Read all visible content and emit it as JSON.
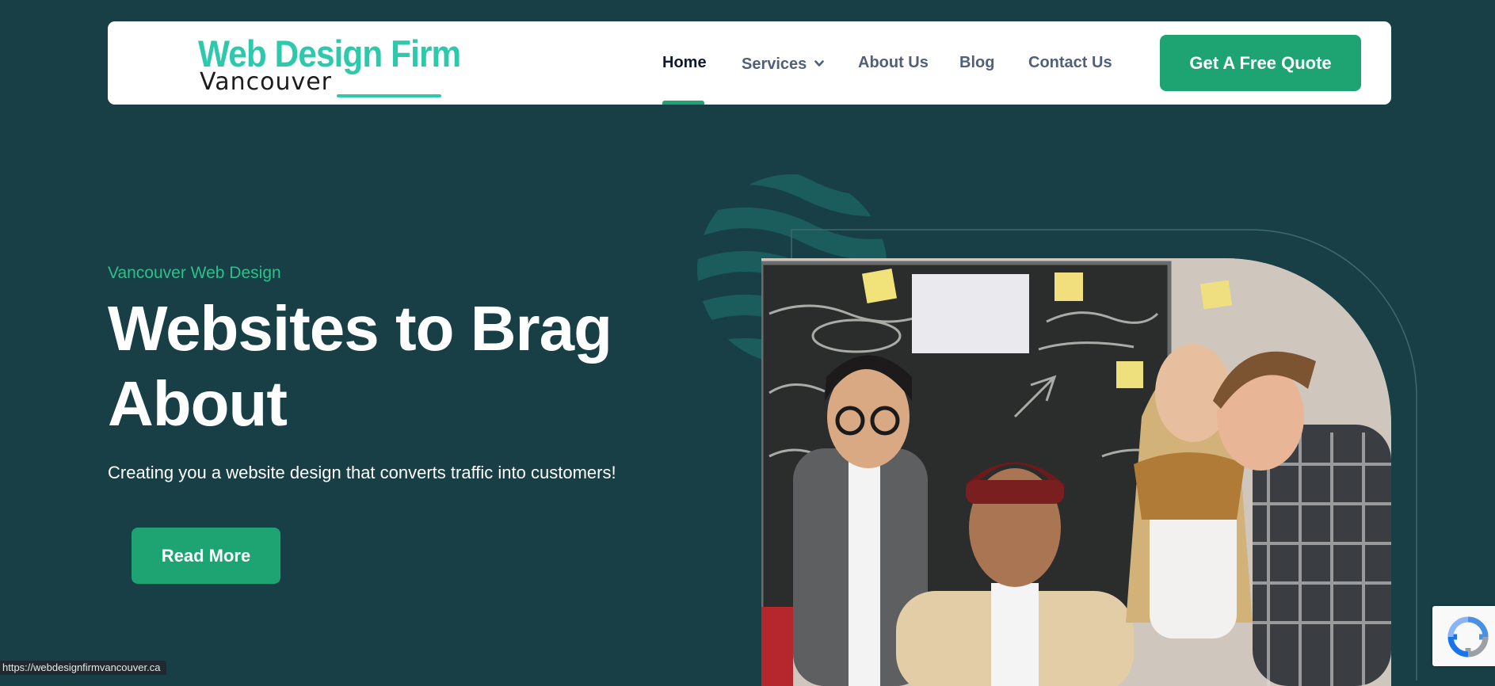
{
  "header": {
    "logo": {
      "main": "Web Design Firm",
      "sub": "Vancouver"
    },
    "nav": [
      {
        "label": "Home",
        "active": true
      },
      {
        "label": "Services",
        "has_dropdown": true
      },
      {
        "label": "About Us"
      },
      {
        "label": "Blog"
      },
      {
        "label": "Contact Us"
      }
    ],
    "cta_label": "Get A Free Quote"
  },
  "hero": {
    "eyebrow": "Vancouver Web Design",
    "title": "Websites to Brag About",
    "subtitle": "Creating you a website design that converts traffic into customers!",
    "button_label": "Read More"
  },
  "status_bar": {
    "url": "https://webdesignfirmvancouver.ca"
  },
  "icons": [
    "chevron-down-icon",
    "recaptcha-icon"
  ],
  "colors": {
    "background": "#173f45",
    "accent": "#1ea373",
    "logo_teal": "#2ec9ad",
    "nav_text": "#51607a",
    "nav_active": "#0f1b2d"
  }
}
